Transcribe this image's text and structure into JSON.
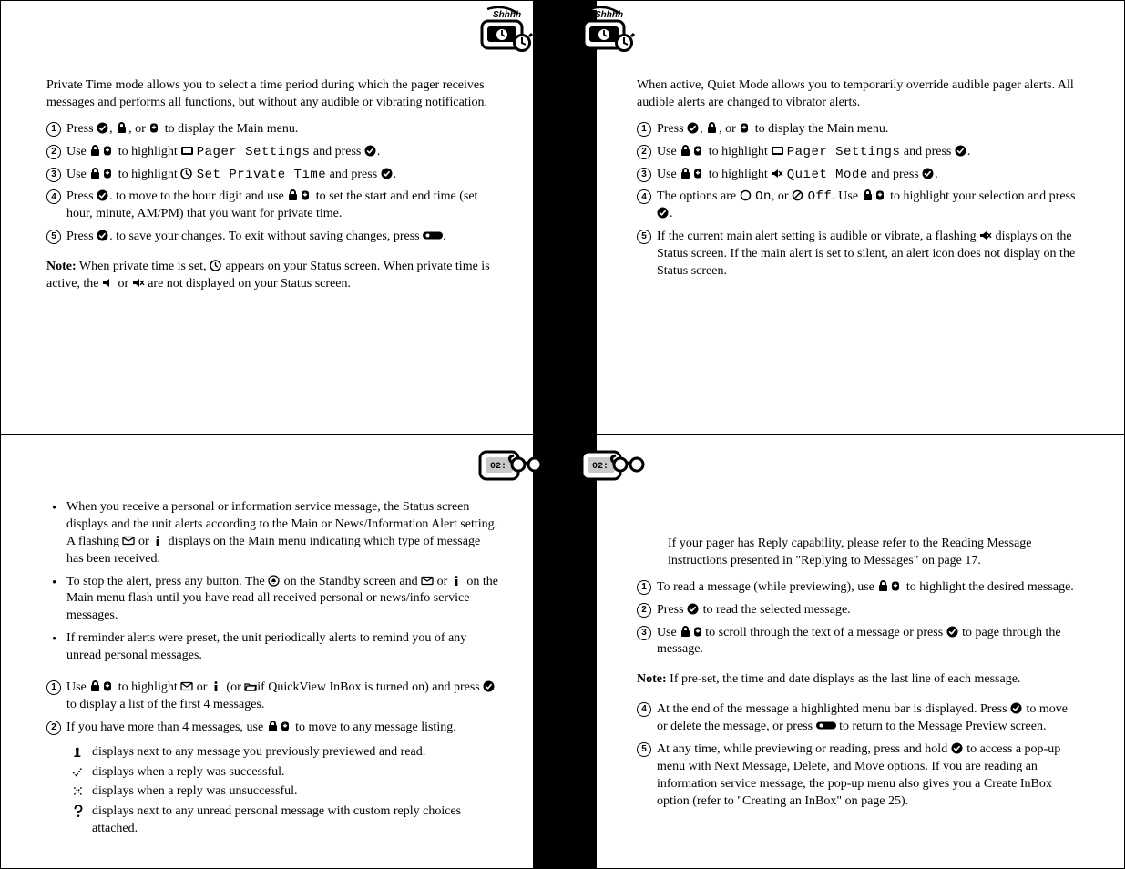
{
  "pages": {
    "tl": {
      "intro": "Private Time mode allows you to select a time period during which the pager receives messages and performs all functions, but without any audible or vibrating notification.",
      "steps": [
        "Press {check}, {lock}, or {down} to display the Main menu.",
        "Use {lock}{down} to highlight {screen} {ps} and press {check}.",
        "Use {lock}{down} to highlight {clock} {spt} and press {check}.",
        "Press {check}. to move to the hour digit and use {lock}{down} to set the start and end time (set hour, minute, AM/PM) that you want for private time.",
        "Press {check}. to save your changes. To exit without saving changes, press {pill}."
      ],
      "note": "Note: When private time is set, {clock} appears on your Status screen. When private time is active, the {spk} or {spkx} are not displayed on your Status screen.",
      "menu": {
        "ps": "Pager Settings",
        "spt": "Set Private Time"
      }
    },
    "tr": {
      "intro": "When active, Quiet Mode allows you to temporarily override audible pager alerts. All audible alerts are changed to vibrator alerts.",
      "steps": [
        "Press {check}, {lock}, or {down} to display the Main menu.",
        "Use {lock}{down} to highlight {screen} {ps} and press {check}.",
        "Use {lock}{down} to highlight {spkx} {qm} and press {check}.",
        "The options are {radio} {on}, or {radiono} {off}. Use {lock}{down} to highlight your selection and press {check}.",
        "If the current main alert setting is audible or vibrate, a flashing {spkx} displays on the Status screen. If the main alert is set to silent, an alert icon does not display on the Status screen."
      ],
      "menu": {
        "ps": "Pager Settings",
        "qm": "Quiet Mode",
        "on": "On",
        "off": "Off"
      }
    },
    "bl": {
      "bullets": [
        "When you receive a personal or information service message, the Status screen displays and the unit alerts according to the Main or News/Information Alert setting. A flashing {env} or {info} displays on the Main menu indicating which type of message has been received.",
        "To stop the alert, press any button. The {bell} on the Standby screen and {env} or {info} on the Main menu flash until you have read all received personal or news/info service messages.",
        "If reminder alerts were preset, the unit periodically alerts to remind you of any unread personal messages."
      ],
      "steps": [
        "Use {lock}{down} to highlight {env} or {info} (or {folder}if QuickView InBox is turned on) and press {check} to display a list of the first 4 messages.",
        "If you have more than 4 messages, use {lock}{down} to move to any message listing."
      ],
      "sub": [
        {
          "icon": "dot",
          "text": "displays next to any message you previously previewed and read."
        },
        {
          "icon": "check",
          "text": "displays when a reply was successful."
        },
        {
          "icon": "x",
          "text": "displays when a reply was unsuccessful."
        },
        {
          "icon": "q",
          "text": "displays next to any unread personal message with custom reply choices attached."
        }
      ]
    },
    "br": {
      "intro": "If your pager has Reply capability, please refer to the Reading Message instructions presented in \"Replying to Messages\" on page 17.",
      "steps": [
        "To read a message (while previewing), use {lock}{down} to highlight the desired message.",
        "Press {check} to read the selected message.",
        "Use {lock}{down}to scroll through the text of a message or press {check} to page through the message."
      ],
      "note": "Note: If pre-set, the time and date displays as the last line of each message.",
      "steps2": [
        "At the end of the message a highlighted menu bar is displayed. Press {check} to move or delete the message, or press {pill} to return to the Message Preview screen.",
        "At any time, while previewing or reading, press and hold {check} to access a pop-up menu with Next Message, Delete, and Move options. If you are reading an information service message, the pop-up menu also gives you a Create InBox option (refer to \"Creating an InBox\" on page 25)."
      ]
    }
  }
}
